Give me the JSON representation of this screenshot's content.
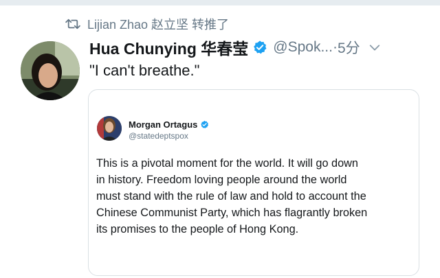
{
  "retweet": {
    "icon": "retweet-icon",
    "label": "Lijian Zhao 赵立坚 转推了"
  },
  "tweet": {
    "author_name": "Hua Chunying 华春莹",
    "verified_icon": "verified-badge-icon",
    "handle": "@Spok...",
    "separator": " · ",
    "time": "5分",
    "menu_icon": "chevron-down-icon",
    "text": "\"I can't breathe.\""
  },
  "quoted": {
    "name": "Morgan Ortagus",
    "handle": "@statedeptspox",
    "text_lines": [
      "This is a pivotal moment for the world. It will go down",
      "in history. Freedom loving people around the world",
      "must stand with the rule of law and hold to account the",
      "Chinese Communist Party, which has flagrantly broken",
      "its promises to the people of Hong Kong."
    ]
  },
  "colors": {
    "accent": "#1da1f2",
    "text_primary": "#14171a",
    "text_secondary": "#657786",
    "border": "#d9dfe3"
  }
}
